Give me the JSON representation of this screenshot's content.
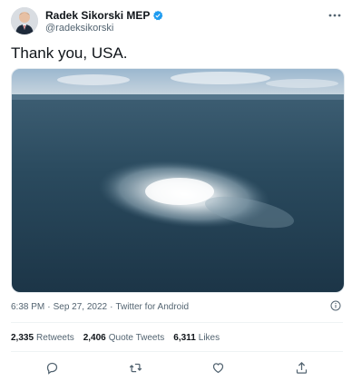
{
  "author": {
    "name": "Radek Sikorski MEP",
    "handle": "@radeksikorski",
    "avatar_icon": "person-avatar",
    "verified_icon": "verified-badge-icon"
  },
  "tweet": {
    "text": "Thank you, USA.",
    "media_icon": "sea-gas-leak-photo"
  },
  "meta": {
    "time": "6:38 PM",
    "separator": "·",
    "date": "Sep 27, 2022",
    "source": "Twitter for Android"
  },
  "stats": {
    "retweets_count": "2,335",
    "retweets_label": "Retweets",
    "quotes_count": "2,406",
    "quotes_label": "Quote Tweets",
    "likes_count": "6,311",
    "likes_label": "Likes"
  },
  "actions": [
    "reply-icon",
    "retweet-icon",
    "like-icon",
    "share-icon"
  ],
  "colors": {
    "text": "#0f1419",
    "secondary": "#536471",
    "verified": "#1d9bf0",
    "divider": "#eff3f4"
  }
}
